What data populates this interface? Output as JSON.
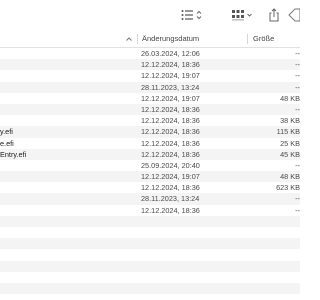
{
  "header": {
    "date_label": "Änderungsdatum",
    "size_label": "Größe",
    "sort_indicator": "chevron-up-icon"
  },
  "toolbar": {
    "icons": [
      "list-view-icon",
      "grid-view-icon",
      "share-icon",
      "tag-icon"
    ]
  },
  "rows": [
    {
      "name": "",
      "date": "26.03.2024, 12:06",
      "size": "--"
    },
    {
      "name": "",
      "date": "12.12.2024, 18:36",
      "size": "--"
    },
    {
      "name": "",
      "date": "12.12.2024, 19:07",
      "size": "--"
    },
    {
      "name": "",
      "date": "28.11.2023, 13:24",
      "size": "--"
    },
    {
      "name": "",
      "date": "12.12.2024, 19:07",
      "size": "48 KB"
    },
    {
      "name": "",
      "date": "12.12.2024, 18:36",
      "size": "--"
    },
    {
      "name": "",
      "date": "12.12.2024, 18:36",
      "size": "38 KB"
    },
    {
      "name": "y.efi",
      "date": "12.12.2024, 18:36",
      "size": "115 KB"
    },
    {
      "name": "e.efi",
      "date": "12.12.2024, 18:36",
      "size": "25 KB"
    },
    {
      "name": "Entry.efi",
      "date": "12.12.2024, 18:36",
      "size": "45 KB"
    },
    {
      "name": "",
      "date": "25.09.2024, 20:40",
      "size": "--"
    },
    {
      "name": "",
      "date": "12.12.2024, 19:07",
      "size": "48 KB"
    },
    {
      "name": "",
      "date": "12.12.2024, 18:36",
      "size": "623 KB"
    },
    {
      "name": "",
      "date": "28.11.2023, 13:24",
      "size": "--"
    },
    {
      "name": "",
      "date": "12.12.2024, 18:36",
      "size": "--"
    },
    {
      "name": "",
      "date": "",
      "size": ""
    },
    {
      "name": "",
      "date": "",
      "size": ""
    },
    {
      "name": "",
      "date": "",
      "size": ""
    },
    {
      "name": "",
      "date": "",
      "size": ""
    },
    {
      "name": "",
      "date": "",
      "size": ""
    },
    {
      "name": "",
      "date": "",
      "size": ""
    },
    {
      "name": "",
      "date": "",
      "size": ""
    }
  ]
}
